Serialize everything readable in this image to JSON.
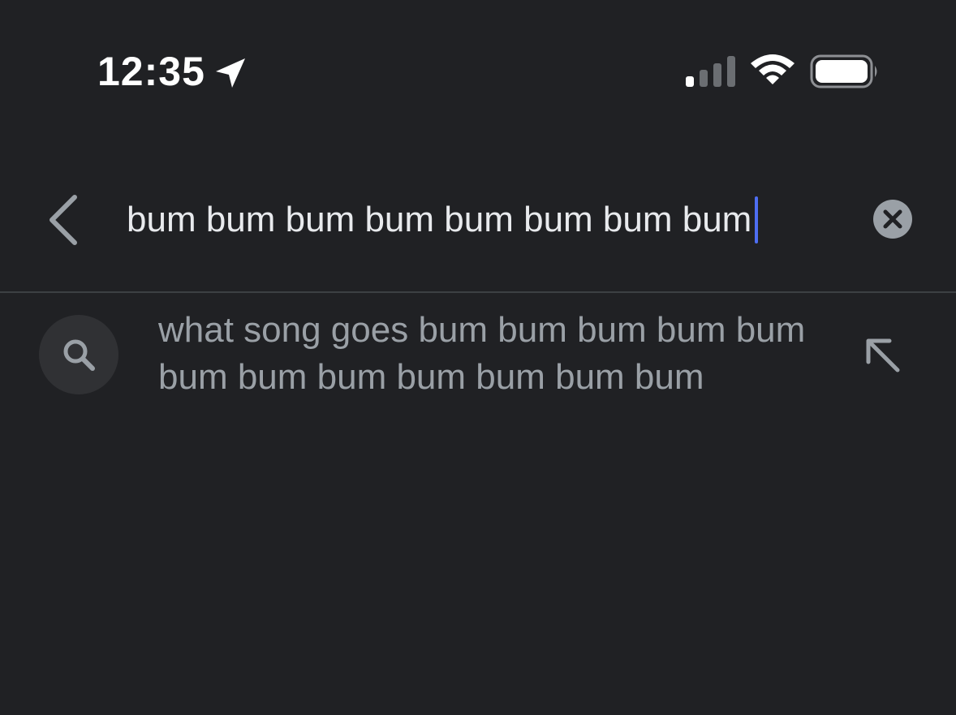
{
  "status_bar": {
    "time": "12:35",
    "location_icon": "location-arrow-icon",
    "signal_icon": "cellular-signal-icon",
    "wifi_icon": "wifi-icon",
    "battery_icon": "battery-icon"
  },
  "search_bar": {
    "back_icon": "chevron-left-icon",
    "query": "bum bum bum bum bum bum bum bum",
    "clear_icon": "clear-circle-icon",
    "caret_color": "#4e6ef2"
  },
  "suggestions": [
    {
      "icon": "search-icon",
      "text": "what song goes bum bum bum bum bum bum bum bum bum bum bum bum",
      "action_icon": "arrow-up-left-icon"
    }
  ],
  "colors": {
    "background": "#202124",
    "primary_text": "#e8eaed",
    "secondary_text": "#9aa0a6"
  }
}
